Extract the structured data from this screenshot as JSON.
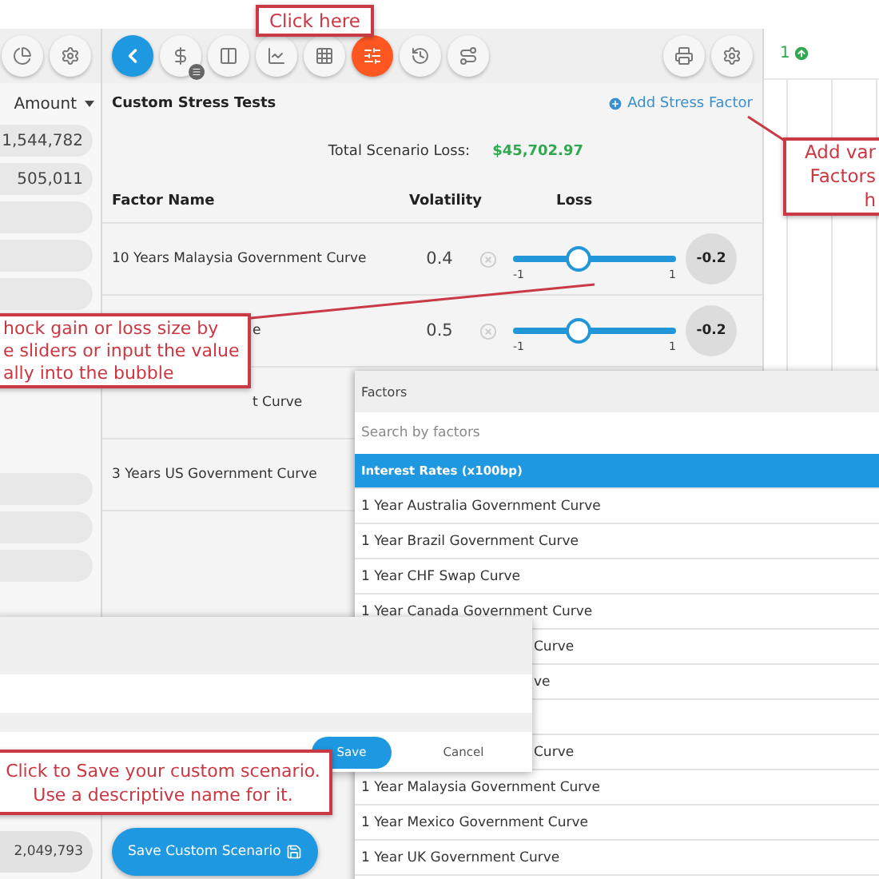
{
  "left_panel": {
    "tools": [
      {
        "kind": "pie"
      },
      {
        "kind": "settings"
      }
    ],
    "column_header": "Amount",
    "amounts": [
      "1,544,782",
      "505,011"
    ],
    "total": "2,049,793"
  },
  "toolbar": [
    {
      "kind": "back",
      "selected": false
    },
    {
      "kind": "dollar",
      "selected": false
    },
    {
      "kind": "columns",
      "selected": false
    },
    {
      "kind": "chart",
      "selected": false
    },
    {
      "kind": "grid",
      "selected": false
    },
    {
      "kind": "sliders",
      "selected": true
    },
    {
      "kind": "history",
      "selected": false
    },
    {
      "kind": "route",
      "selected": false
    },
    {
      "kind": "spacer"
    },
    {
      "kind": "print",
      "selected": false
    },
    {
      "kind": "settings",
      "selected": false
    }
  ],
  "panel": {
    "title": "Custom Stress Tests",
    "add_link": "Add Stress Factor",
    "total_label": "Total Scenario Loss:",
    "total_value": "$45,702.97",
    "columns": [
      "Factor Name",
      "Volatility",
      "Loss"
    ],
    "rows": [
      {
        "kind": "full",
        "name": "10 Years Malaysia Government Curve",
        "volatility": "0.4",
        "level": 0.4,
        "loss": "-0.2",
        "min": "-1",
        "max": "1"
      },
      {
        "kind": "covered",
        "name": "e",
        "volatility": "0.5",
        "level": 0.4,
        "loss": "-0.2",
        "min": "-1",
        "max": "1"
      },
      {
        "kind": "covered",
        "name": "t Curve"
      },
      {
        "kind": "full",
        "name": "3 Years US Government Curve"
      }
    ],
    "save_button": "Save Custom Scenario"
  },
  "right_panel": {
    "count": "1"
  },
  "factors_dropdown": {
    "title": "Factors",
    "placeholder": "Search by factors",
    "items": [
      {
        "kind": "group",
        "label": "Interest Rates (x100bp)",
        "selected": true
      },
      {
        "kind": "item",
        "label": "1 Year Australia Government Curve",
        "selected": false
      },
      {
        "kind": "item",
        "label": "1 Year Brazil Government Curve",
        "selected": false
      },
      {
        "kind": "item",
        "label": "1 Year CHF Swap Curve",
        "selected": false
      },
      {
        "kind": "item",
        "label": "1 Year Canada Government Curve",
        "selected": false
      },
      {
        "kind": "covered",
        "label": "Curve",
        "selected": false
      },
      {
        "kind": "covered",
        "label": "ve",
        "selected": false
      },
      {
        "kind": "covered",
        "selected": false
      },
      {
        "kind": "covered",
        "label": "Curve",
        "selected": false
      },
      {
        "kind": "item",
        "label": "1 Year Malaysia Government Curve",
        "selected": false
      },
      {
        "kind": "item",
        "label": "1 Year Mexico Government Curve",
        "selected": false
      },
      {
        "kind": "item",
        "label": "1 Year UK Government Curve",
        "selected": false
      }
    ]
  },
  "save_dialog": {
    "buttons": [
      "Save",
      "Cancel"
    ]
  },
  "callouts": [
    {
      "kind": "top",
      "lines": [
        "Click here"
      ]
    },
    {
      "kind": "right",
      "lines": [
        "Add var",
        "Factors",
        "h"
      ]
    },
    {
      "kind": "left",
      "lines": [
        "hock gain or loss size by",
        "e sliders or input the value",
        "ally into the bubble"
      ]
    },
    {
      "kind": "bottom",
      "lines": [
        "Click to Save your custom scenario.",
        "Use a descriptive name for it."
      ]
    }
  ]
}
